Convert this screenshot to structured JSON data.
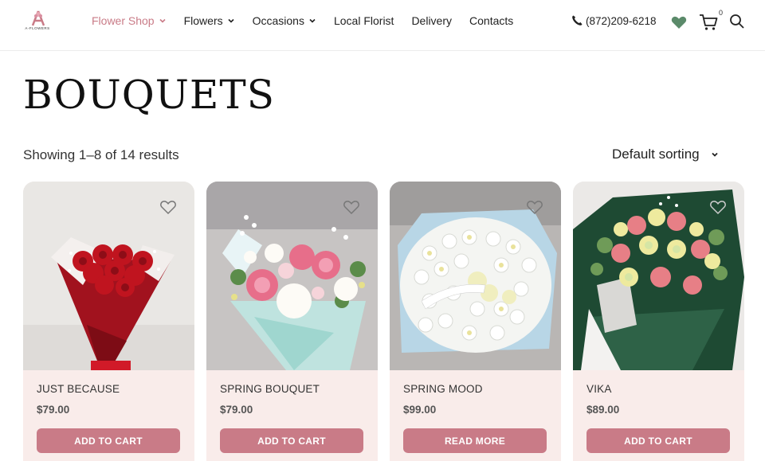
{
  "logo": {
    "text": "A-FLOWERS"
  },
  "nav": {
    "items": [
      {
        "label": "Flower Shop",
        "dropdown": true,
        "active": true
      },
      {
        "label": "Flowers",
        "dropdown": true,
        "active": false
      },
      {
        "label": "Occasions",
        "dropdown": true,
        "active": false
      },
      {
        "label": "Local Florist",
        "dropdown": false,
        "active": false
      },
      {
        "label": "Delivery",
        "dropdown": false,
        "active": false
      },
      {
        "label": "Contacts",
        "dropdown": false,
        "active": false
      }
    ]
  },
  "header": {
    "phone": "(872)209-6218",
    "cart_count": "0",
    "icons": [
      "phone-icon",
      "heart-icon",
      "cart-icon",
      "search-icon"
    ]
  },
  "page": {
    "title": "BOUQUETS",
    "result_count": "Showing 1–8 of 14 results",
    "sorting": "Default sorting"
  },
  "products": [
    {
      "name": "JUST BECAUSE",
      "price": "$79.00",
      "button": "ADD TO CART"
    },
    {
      "name": "SPRING BOUQUET",
      "price": "$79.00",
      "button": "ADD TO CART"
    },
    {
      "name": "SPRING MOOD",
      "price": "$99.00",
      "button": "READ MORE"
    },
    {
      "name": "VIKA",
      "price": "$89.00",
      "button": "ADD TO CART"
    }
  ],
  "colors": {
    "accent": "#c97b87",
    "card_bg": "#f9ecea",
    "heart": "#5b8a6a"
  }
}
